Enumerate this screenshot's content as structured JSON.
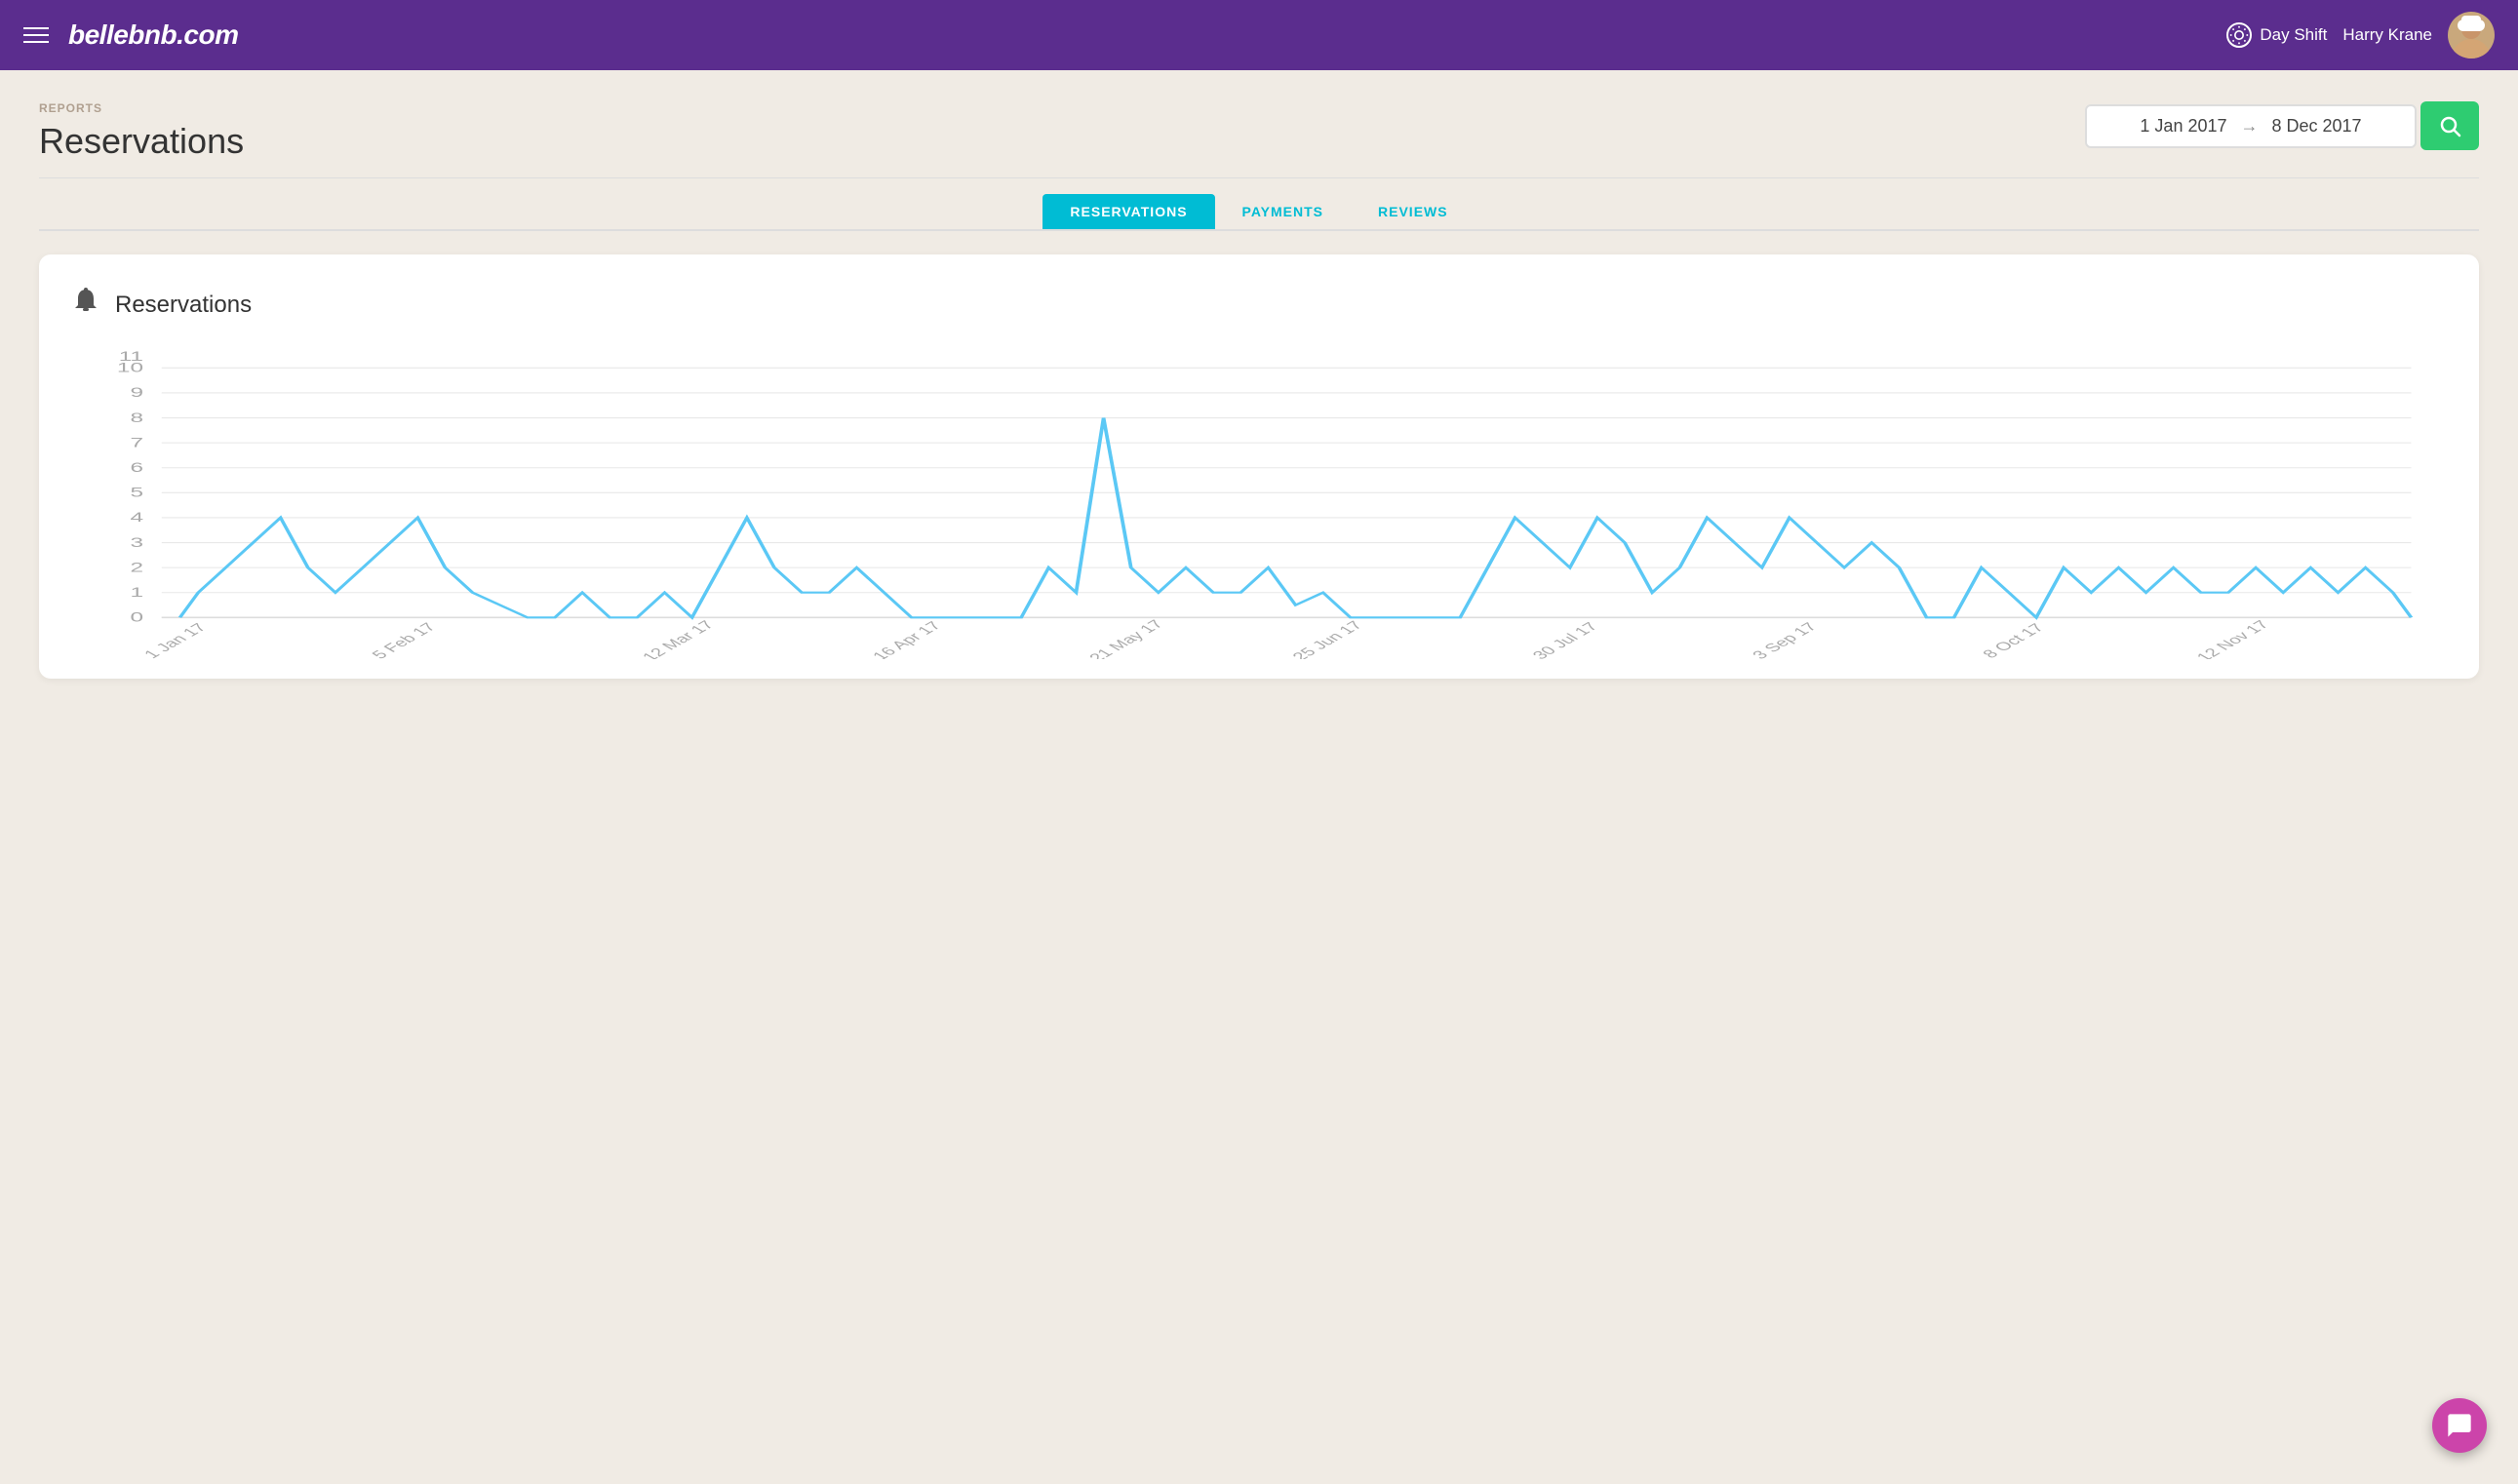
{
  "header": {
    "logo": "bellebnb.com",
    "day_shift_label": "Day Shift",
    "username": "Harry Krane",
    "day_shift_icon": "☀"
  },
  "breadcrumb": "REPORTS",
  "page_title": "Reservations",
  "date_range": {
    "start": "1 Jan 2017",
    "arrow": "→",
    "end": "8 Dec 2017"
  },
  "tabs": [
    {
      "id": "reservations",
      "label": "RESERVATIONS",
      "active": true
    },
    {
      "id": "payments",
      "label": "PAYMENTS",
      "active": false
    },
    {
      "id": "reviews",
      "label": "REVIEWS",
      "active": false
    }
  ],
  "chart": {
    "title": "Reservations",
    "bell_icon": "🔔",
    "y_labels": [
      "0",
      "1",
      "2",
      "3",
      "4",
      "5",
      "6",
      "7",
      "8",
      "9",
      "10",
      "11"
    ],
    "x_labels": [
      "1 Jan 17",
      "5 Feb 17",
      "12 Mar 17",
      "16 Apr 17",
      "21 May 17",
      "25 Jun 17",
      "30 Jul 17",
      "3 Sep 17",
      "8 Oct 17",
      "12 Nov 17"
    ]
  },
  "search_button_label": "Search",
  "chat_button_label": "Chat"
}
